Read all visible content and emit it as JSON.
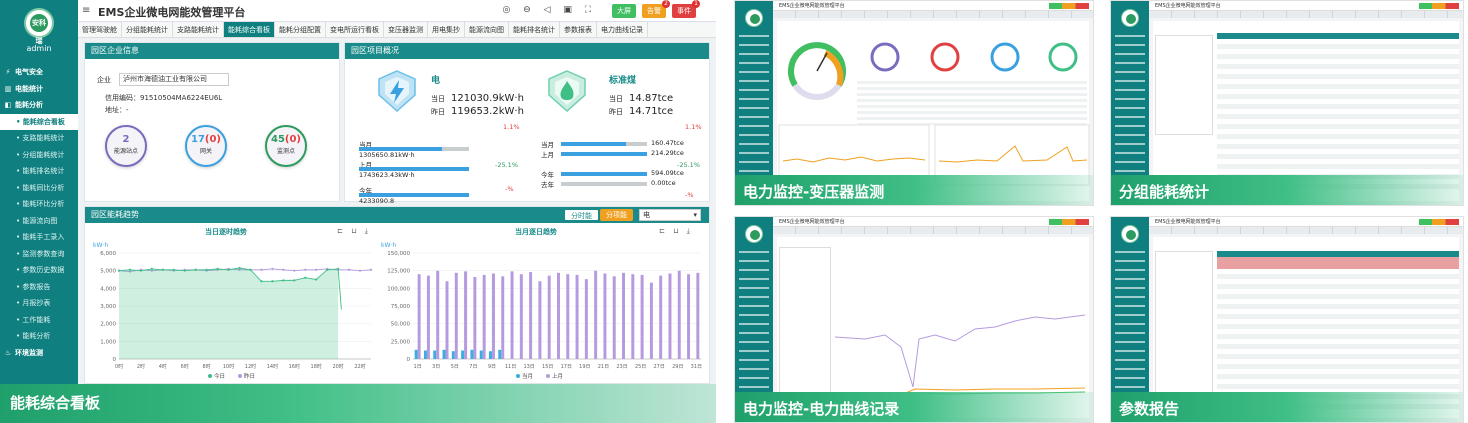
{
  "app": {
    "title": "EMS企业微电网能效管理平台",
    "user": "admin",
    "logo_text": "安科瑞",
    "top_icons": "◎ ⊖ ◁ ▣ ⛶",
    "buttons": {
      "screen": "大屏",
      "alarm": "告警",
      "event": "事件"
    },
    "badges": {
      "alarm": "2",
      "event": "1"
    }
  },
  "sidebar": [
    {
      "label": "电气安全",
      "type": "group",
      "icon": "⚡"
    },
    {
      "label": "电能统计",
      "type": "group",
      "icon": "▥"
    },
    {
      "label": "能耗分析",
      "type": "group",
      "icon": "◧"
    },
    {
      "label": "能耗综合看板",
      "type": "sub",
      "active": true
    },
    {
      "label": "支路能耗统计",
      "type": "sub"
    },
    {
      "label": "分组能耗统计",
      "type": "sub"
    },
    {
      "label": "能耗排名统计",
      "type": "sub"
    },
    {
      "label": "能耗同比分析",
      "type": "sub"
    },
    {
      "label": "能耗环比分析",
      "type": "sub"
    },
    {
      "label": "能源流向图",
      "type": "sub"
    },
    {
      "label": "能耗手工录入",
      "type": "sub"
    },
    {
      "label": "监测参数查询",
      "type": "sub"
    },
    {
      "label": "参数历史数据",
      "type": "sub"
    },
    {
      "label": "参数报告",
      "type": "sub"
    },
    {
      "label": "月报抄表",
      "type": "sub"
    },
    {
      "label": "工作能耗",
      "type": "sub"
    },
    {
      "label": "能耗分析",
      "type": "sub"
    },
    {
      "label": "环境监测",
      "type": "group",
      "icon": "♨"
    }
  ],
  "tabs": [
    "管理驾驶舱",
    "分组能耗统计",
    "支路能耗统计",
    "能耗综合看板",
    "能耗分组配置",
    "变电所运行看板",
    "变压器监测",
    "用电集抄",
    "能源流向图",
    "能耗排名统计",
    "参数报表",
    "电力曲线记录"
  ],
  "active_tab": 3,
  "company": {
    "header": "园区企业信息",
    "label": "企业",
    "name": "泸州市海德油工业有限公司",
    "credit_label": "信用编码：",
    "credit": "91510504MA6224EU6L",
    "address_label": "地址：",
    "address": "-",
    "circles": [
      {
        "num": "2",
        "label": "能源站点",
        "color": "#7a6bbf"
      },
      {
        "num": "17(0)",
        "label": "网关",
        "color": "#3aa0e0",
        "red_part": "(0)"
      },
      {
        "num": "45(0)",
        "label": "监测点",
        "color": "#2d9a5f",
        "red_part": "(0)"
      }
    ]
  },
  "energy": {
    "header": "园区项目概况",
    "elec": {
      "title": "电",
      "today_label": "当日",
      "today": "121030.9kW·h",
      "yesterday_label": "昨日",
      "yesterday": "119653.2kW·h",
      "day_change": "1.1%",
      "month_label": "当月",
      "month": "1305650.81kW·h",
      "last_month_label": "上月",
      "last_month": "1743623.43kW·h",
      "month_change": "-25.1%",
      "year_label": "今年",
      "year": "",
      "year_change": "-%",
      "cut_value": "4233090.8"
    },
    "coal": {
      "title": "标准煤",
      "today_label": "当日",
      "today": "14.87tce",
      "yesterday_label": "昨日",
      "yesterday": "14.71tce",
      "day_change": "1.1%",
      "month_label": "当月",
      "month": "160.47tce",
      "last_month_label": "上月",
      "last_month": "214.29tce",
      "month_change": "-25.1%",
      "year_label": "今年",
      "year": "594.09tce",
      "last_year_label": "去年",
      "last_year": "0.00tce",
      "year_change": "-%"
    }
  },
  "trend": {
    "header": "园区能耗趋势",
    "btn_time": "分时能",
    "btn_energy": "分项能",
    "select": "电",
    "tool_icons": "⊏ ⊔ ⤓"
  },
  "chart_data": [
    {
      "type": "area",
      "title": "当日逐时趋势",
      "ylabel": "kW·h",
      "ylim": [
        0,
        6000
      ],
      "yticks": [
        "6,000",
        "5,000",
        "4,000",
        "3,000",
        "2,000",
        "1,000",
        "0"
      ],
      "categories": [
        "0时",
        "1时",
        "2时",
        "3时",
        "4时",
        "5时",
        "6时",
        "7时",
        "8时",
        "9时",
        "10时",
        "11时",
        "12时",
        "13时",
        "14时",
        "15时",
        "16时",
        "17时",
        "18时",
        "19时",
        "20时",
        "21时",
        "22时",
        "23时"
      ],
      "xtick_labels": [
        "0时",
        "2时",
        "4时",
        "6时",
        "8时",
        "10时",
        "12时",
        "14时",
        "16时",
        "18时",
        "20时",
        "22时"
      ],
      "series": [
        {
          "name": "今日",
          "color": "#3fbf86",
          "values": [
            5000,
            5050,
            5000,
            5100,
            5050,
            5050,
            5000,
            5050,
            5050,
            5100,
            5050,
            5150,
            5050,
            4400,
            4400,
            4450,
            4450,
            4600,
            4500,
            5050,
            5100,
            null,
            null,
            null
          ]
        },
        {
          "name": "昨日",
          "color": "#b59ae0",
          "values": [
            5000,
            4950,
            5050,
            5000,
            5050,
            5000,
            5050,
            5050,
            5000,
            5050,
            5100,
            5050,
            5050,
            5050,
            5100,
            5050,
            5000,
            5050,
            5050,
            5100,
            5050,
            5050,
            5000,
            5050
          ]
        }
      ]
    },
    {
      "type": "bar",
      "title": "当月逐日趋势",
      "ylabel": "kW·h",
      "ylim": [
        0,
        150000
      ],
      "yticks": [
        "150,000",
        "125,000",
        "100,000",
        "75,000",
        "50,000",
        "25,000",
        "0"
      ],
      "categories": [
        "1日",
        "2日",
        "3日",
        "4日",
        "5日",
        "6日",
        "7日",
        "8日",
        "9日",
        "10日",
        "11日",
        "12日",
        "13日",
        "14日",
        "15日",
        "16日",
        "17日",
        "18日",
        "19日",
        "20日",
        "21日",
        "22日",
        "23日",
        "24日",
        "25日",
        "26日",
        "27日",
        "28日",
        "29日",
        "30日",
        "31日"
      ],
      "xtick_labels": [
        "1日",
        "3日",
        "5日",
        "7日",
        "9日",
        "11日",
        "13日",
        "15日",
        "17日",
        "19日",
        "21日",
        "23日",
        "25日",
        "27日",
        "29日",
        "31日"
      ],
      "series": [
        {
          "name": "当月",
          "color": "#3aaee0",
          "values": [
            13000,
            12000,
            12000,
            13000,
            11000,
            12000,
            13000,
            12000,
            11000,
            13000,
            null,
            null,
            null,
            null,
            null,
            null,
            null,
            null,
            null,
            null,
            null,
            null,
            null,
            null,
            null,
            null,
            null,
            null,
            null,
            null,
            null
          ]
        },
        {
          "name": "上月",
          "color": "#b59ae0",
          "values": [
            120000,
            118000,
            125000,
            110000,
            122000,
            124000,
            116000,
            119000,
            121000,
            117000,
            124000,
            120000,
            123000,
            110000,
            118000,
            122000,
            120000,
            119000,
            113000,
            125000,
            121000,
            117000,
            122000,
            120000,
            119000,
            108000,
            118000,
            121000,
            125000,
            120000,
            122000
          ]
        }
      ]
    }
  ],
  "caption": "能耗综合看板",
  "thumbnails": [
    {
      "caption": "电力监控-变压器监测",
      "title": "EMS企业微电网能效管理平台"
    },
    {
      "caption": "分组能耗统计",
      "title": "EMS企业微电网能效管理平台"
    },
    {
      "caption": "电力监控-电力曲线记录",
      "title": "EMS企业微电网能效管理平台"
    },
    {
      "caption": "参数报告",
      "title": "EMS企业微电网能效管理平台"
    }
  ]
}
